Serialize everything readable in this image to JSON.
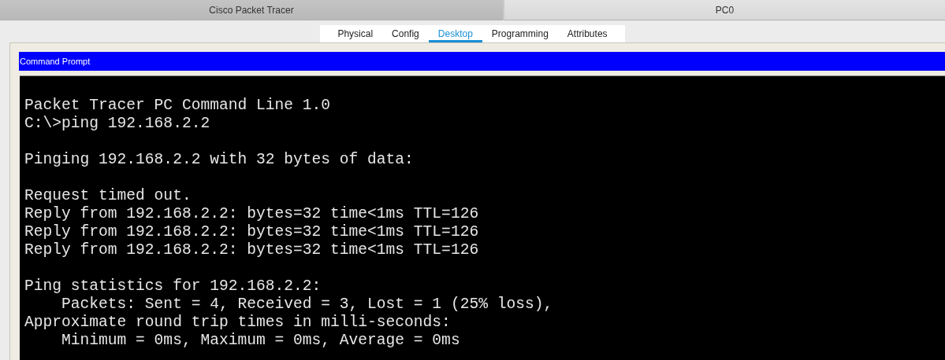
{
  "window_tabs": [
    {
      "label": "Cisco Packet Tracer",
      "selected": false
    },
    {
      "label": "PC0",
      "selected": true
    }
  ],
  "tabs": [
    {
      "label": "Physical",
      "selected": false
    },
    {
      "label": "Config",
      "selected": false
    },
    {
      "label": "Desktop",
      "selected": true
    },
    {
      "label": "Programming",
      "selected": false
    },
    {
      "label": "Attributes",
      "selected": false
    }
  ],
  "command_prompt": {
    "title": "Command Prompt",
    "blocks": [
      [
        "Packet Tracer PC Command Line 1.0",
        "C:\\>ping 192.168.2.2"
      ],
      [
        "Pinging 192.168.2.2 with 32 bytes of data:"
      ],
      [
        "Request timed out.",
        "Reply from 192.168.2.2: bytes=32 time<1ms TTL=126",
        "Reply from 192.168.2.2: bytes=32 time<1ms TTL=126",
        "Reply from 192.168.2.2: bytes=32 time<1ms TTL=126"
      ],
      [
        "Ping statistics for 192.168.2.2:",
        "    Packets: Sent = 4, Received = 3, Lost = 1 (25% loss),",
        "Approximate round trip times in milli-seconds:",
        "    Minimum = 0ms, Maximum = 0ms, Average = 0ms"
      ]
    ]
  }
}
